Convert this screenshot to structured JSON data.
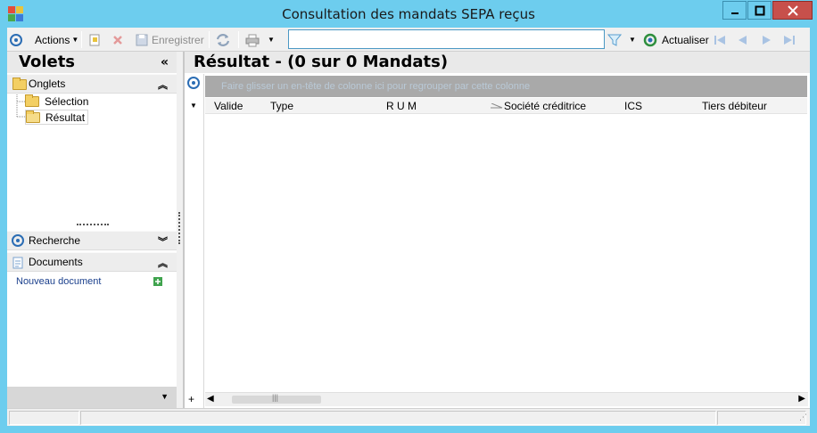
{
  "window": {
    "title": "Consultation des mandats SEPA reçus"
  },
  "toolbar": {
    "actions_label": "Actions",
    "save_label": "Enregistrer",
    "search_value": "",
    "refresh_label": "Actualiser"
  },
  "left_pane": {
    "title": "Volets",
    "onglets": {
      "label": "Onglets",
      "items": [
        "Sélection",
        "Résultat"
      ]
    },
    "recherche_label": "Recherche",
    "documents": {
      "label": "Documents",
      "new_document_label": "Nouveau document"
    }
  },
  "result": {
    "title": "Résultat - (0 sur 0 Mandats)",
    "group_hint": "Faire glisser un en-tête de colonne ici pour regrouper par cette colonne",
    "columns": [
      "Valide",
      "Type",
      "R U M",
      "Société créditrice",
      "ICS",
      "Tiers débiteur"
    ]
  },
  "colors": {
    "titlebar": "#6dcdee",
    "close_button": "#c7504b",
    "accent_blue": "#2b6db4"
  }
}
